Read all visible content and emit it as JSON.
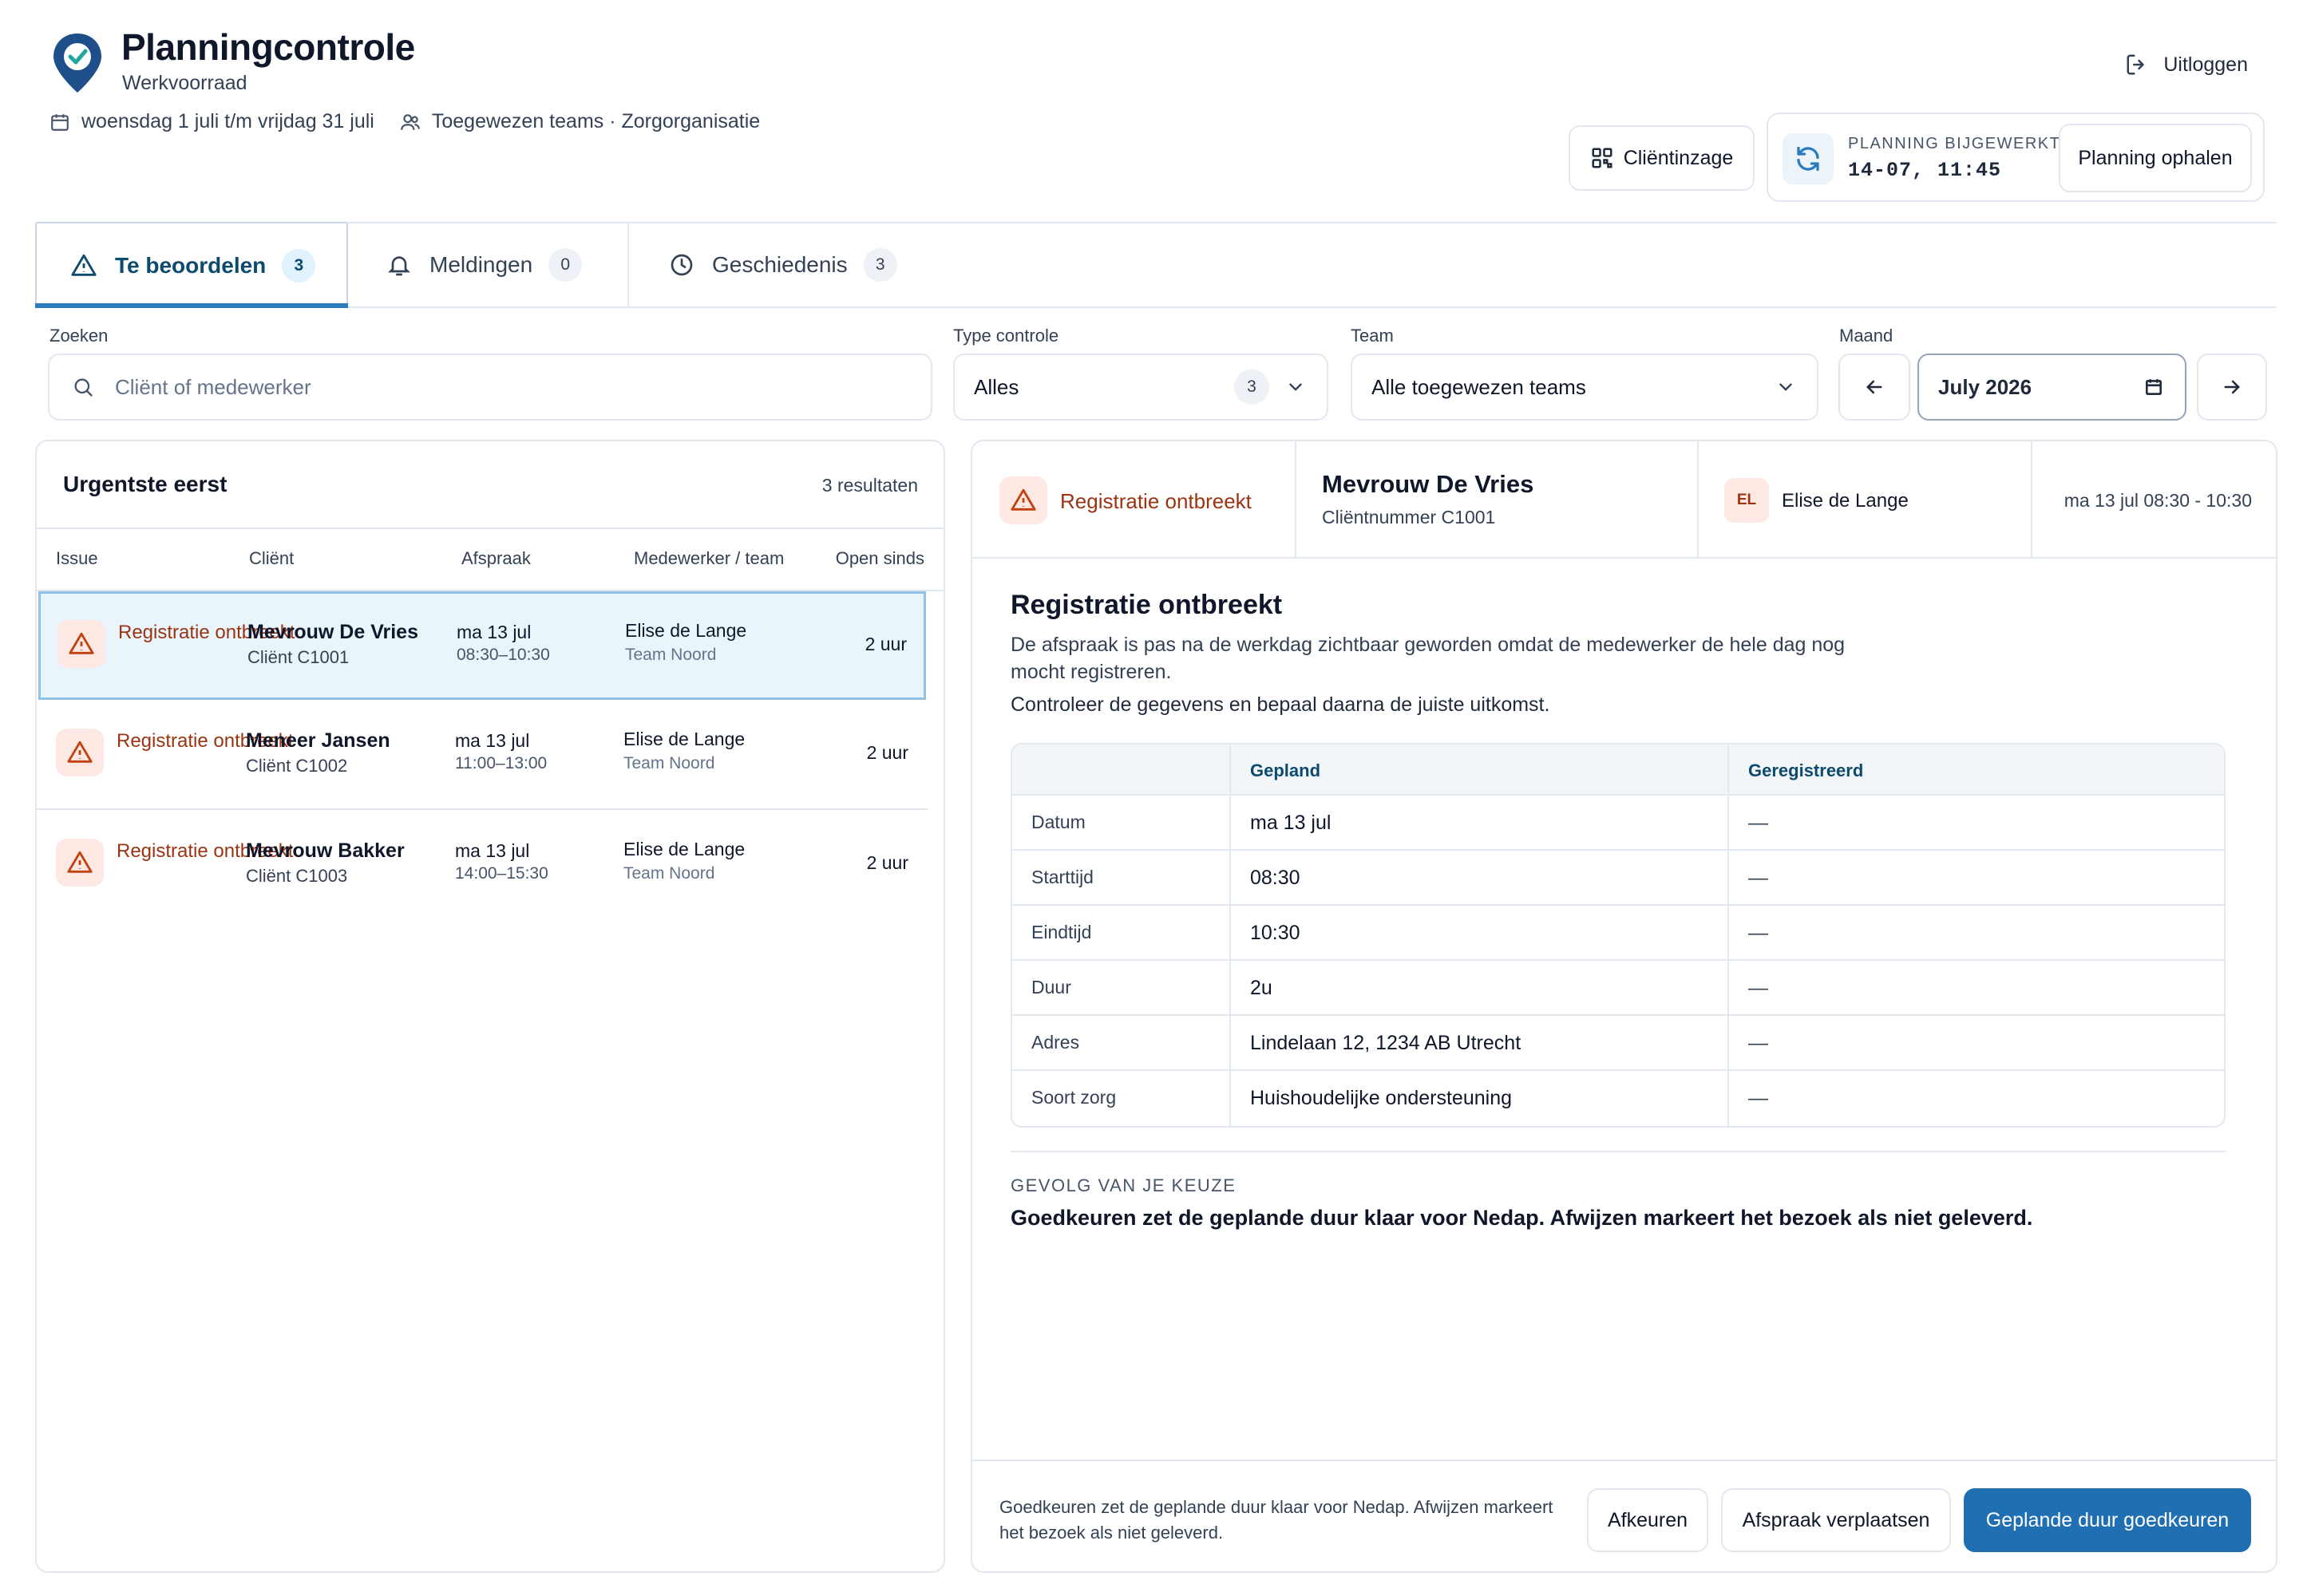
{
  "header": {
    "title": "Planningcontrole",
    "subtitle": "Werkvoorraad",
    "date_range": "woensdag 1 juli t/m vrijdag 31 juli",
    "teams": "Toegewezen teams · Zorgorganisatie",
    "logout_label": "Uitloggen",
    "client_view_label": "Cliëntinzage",
    "plan_updated_label": "PLANNING BIJGEWERKT",
    "plan_updated_time": "14-07, 11:45",
    "fetch_label": "Planning ophalen"
  },
  "tabs": [
    {
      "label": "Te beoordelen",
      "count": "3",
      "active": true
    },
    {
      "label": "Meldingen",
      "count": "0",
      "active": false
    },
    {
      "label": "Geschiedenis",
      "count": "3",
      "active": false
    }
  ],
  "filters": {
    "search_label": "Zoeken",
    "search_placeholder": "Cliënt of medewerker",
    "type_label": "Type controle",
    "type_value": "Alles",
    "type_count": "3",
    "team_label": "Team",
    "team_value": "Alle toegewezen teams",
    "month_label": "Maand",
    "month_value": "July 2026"
  },
  "list": {
    "title": "Urgentste eerst",
    "result_count": "3 resultaten",
    "columns": [
      "Issue",
      "Cliënt",
      "Afspraak",
      "Medewerker / team",
      "Open sinds"
    ],
    "rows": [
      {
        "issue": "Registratie ontbreekt",
        "client": "Mevrouw De Vries",
        "client_id": "Cliënt C1001",
        "date": "ma 13 jul",
        "time": "08:30–10:30",
        "employee": "Elise de Lange",
        "team": "Team Noord",
        "open_since": "2 uur",
        "selected": true
      },
      {
        "issue": "Registratie ontbreekt",
        "client": "Meneer Jansen",
        "client_id": "Cliënt C1002",
        "date": "ma 13 jul",
        "time": "11:00–13:00",
        "employee": "Elise de Lange",
        "team": "Team Noord",
        "open_since": "2 uur",
        "selected": false
      },
      {
        "issue": "Registratie ontbreekt",
        "client": "Mevrouw Bakker",
        "client_id": "Cliënt C1003",
        "date": "ma 13 jul",
        "time": "14:00–15:30",
        "employee": "Elise de Lange",
        "team": "Team Noord",
        "open_since": "2 uur",
        "selected": false
      }
    ]
  },
  "detail": {
    "issue": "Registratie ontbreekt",
    "client": "Mevrouw De Vries",
    "client_number": "Cliëntnummer C1001",
    "employee_initials": "EL",
    "employee": "Elise de Lange",
    "when": "ma 13 jul 08:30 - 10:30",
    "title": "Registratie ontbreekt",
    "description": "De afspraak is pas na de werkdag zichtbaar geworden omdat de medewerker de hele dag nog mocht registreren.",
    "instruction": "Controleer de gegevens en bepaal daarna de juiste uitkomst.",
    "compare_headers": [
      "Gepland",
      "Geregistreerd"
    ],
    "compare_rows": [
      {
        "label": "Datum",
        "planned": "ma 13 jul",
        "registered": "—"
      },
      {
        "label": "Starttijd",
        "planned": "08:30",
        "registered": "—"
      },
      {
        "label": "Eindtijd",
        "planned": "10:30",
        "registered": "—"
      },
      {
        "label": "Duur",
        "planned": "2u",
        "registered": "—"
      },
      {
        "label": "Adres",
        "planned": "Lindelaan 12, 1234 AB Utrecht",
        "registered": "—"
      },
      {
        "label": "Soort zorg",
        "planned": "Huishoudelijke ondersteuning",
        "registered": "—"
      }
    ],
    "consequence_label": "GEVOLG VAN JE KEUZE",
    "consequence_text": "Goedkeuren zet de geplande duur klaar voor Nedap. Afwijzen markeert het bezoek als niet geleverd."
  },
  "footer": {
    "note": "Goedkeuren zet de geplande duur klaar voor Nedap. Afwijzen markeert het bezoek als niet geleverd.",
    "reject_label": "Afkeuren",
    "move_label": "Afspraak verplaatsen",
    "approve_label": "Geplande duur goedkeuren"
  },
  "colors": {
    "primary": "#1f6fb2",
    "accent_text": "#0c4a6e",
    "warning_bg": "#fde8e4",
    "warning_text": "#9a3412",
    "selected_row_bg": "#eaf4fb"
  }
}
